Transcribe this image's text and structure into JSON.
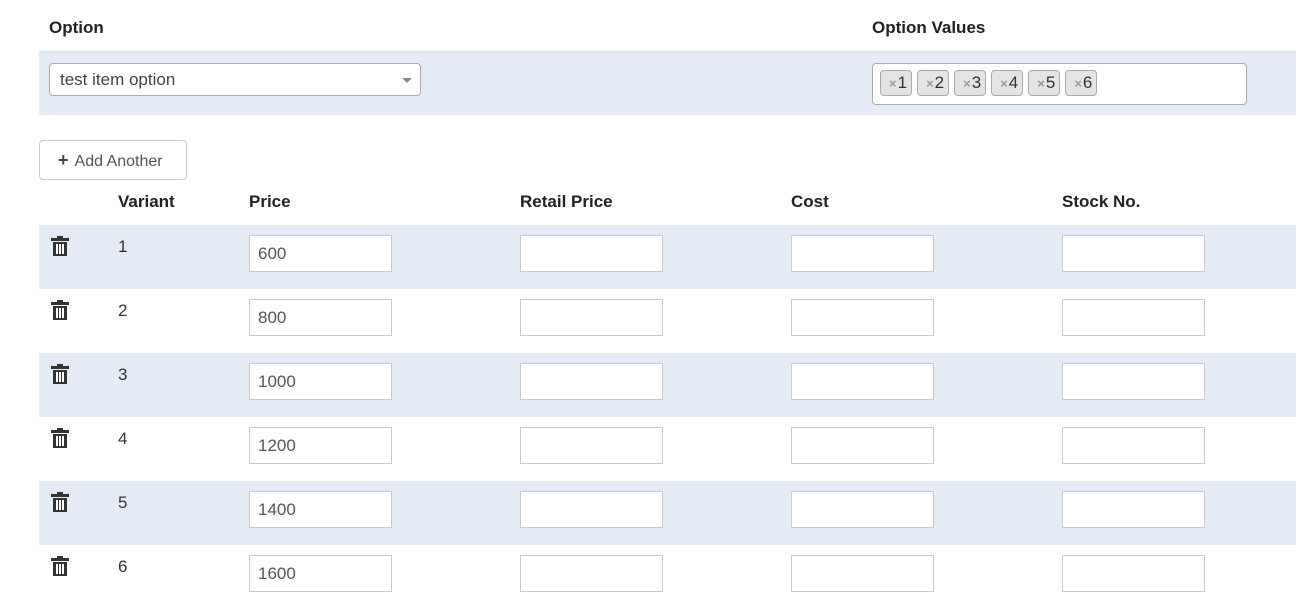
{
  "option_section": {
    "option_header": "Option",
    "values_header": "Option Values",
    "selected_option": "test item option",
    "values": [
      "1",
      "2",
      "3",
      "4",
      "5",
      "6"
    ]
  },
  "add_button_label": "Add Another",
  "table": {
    "headers": [
      "Variant",
      "Price",
      "Retail Price",
      "Cost",
      "Stock No."
    ],
    "rows": [
      {
        "variant": "1",
        "price": "600",
        "retail_price": "",
        "cost": "",
        "stock_no": ""
      },
      {
        "variant": "2",
        "price": "800",
        "retail_price": "",
        "cost": "",
        "stock_no": ""
      },
      {
        "variant": "3",
        "price": "1000",
        "retail_price": "",
        "cost": "",
        "stock_no": ""
      },
      {
        "variant": "4",
        "price": "1200",
        "retail_price": "",
        "cost": "",
        "stock_no": ""
      },
      {
        "variant": "5",
        "price": "1400",
        "retail_price": "",
        "cost": "",
        "stock_no": ""
      },
      {
        "variant": "6",
        "price": "1600",
        "retail_price": "",
        "cost": "",
        "stock_no": ""
      }
    ]
  },
  "icons": {
    "delete": "trash-icon",
    "add": "plus-icon",
    "remove_value": "close-icon",
    "dropdown": "chevron-down-icon"
  },
  "colors": {
    "band": "#e4ebf4",
    "chip": "#e4e4e4"
  }
}
